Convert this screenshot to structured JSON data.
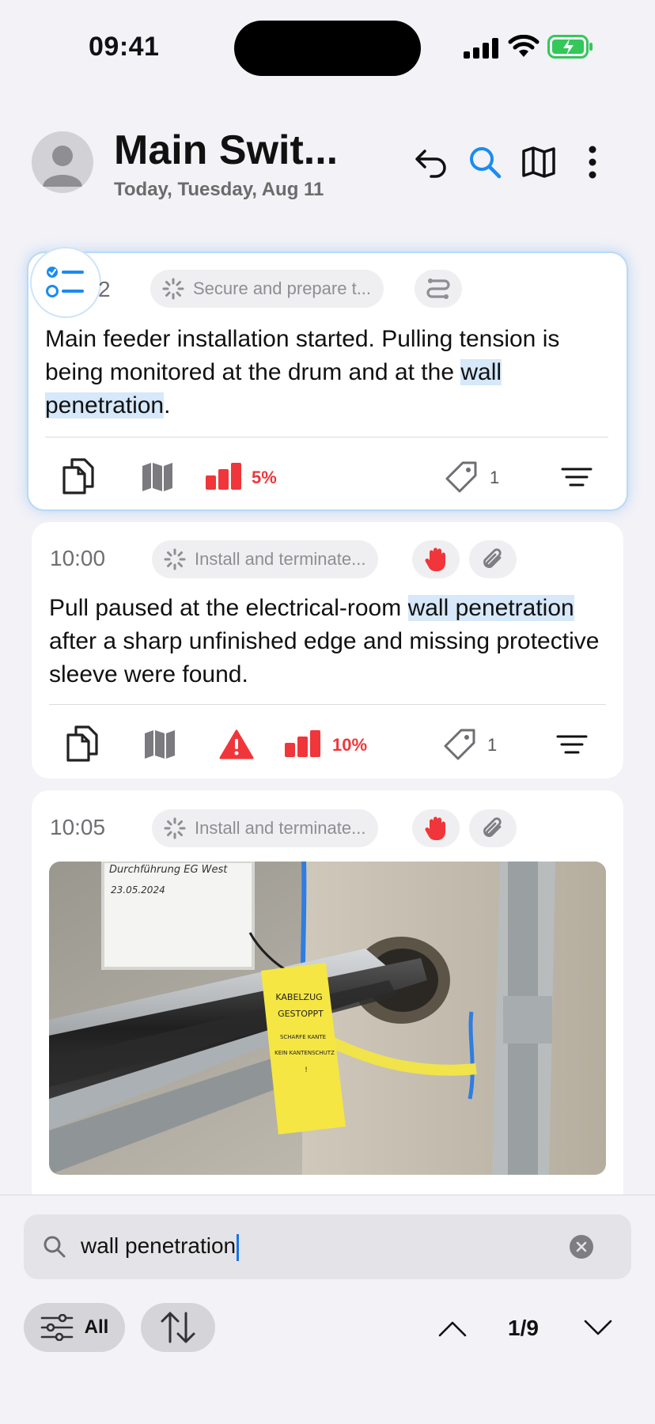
{
  "status_bar": {
    "time": "09:41"
  },
  "header": {
    "title": "Main Swit...",
    "subtitle": "Today, Tuesday, Aug 11"
  },
  "entries": [
    {
      "time": "2",
      "task": "Secure and prepare t...",
      "text_before": "Main feeder installation started. Pulling tension is being monitored at the drum and at the ",
      "highlight": "wall penetration",
      "text_after": ".",
      "progress": "5%",
      "tags_count": "1"
    },
    {
      "time": "10:00",
      "task": "Install and terminate...",
      "text_before": "Pull paused at the electrical-room ",
      "highlight": "wall penetration",
      "text_after": " after a sharp unfinished edge and missing protective sleeve were found.",
      "progress": "10%",
      "tags_count": "1"
    },
    {
      "time": "10:05",
      "task": "Install and terminate...",
      "photo": {
        "board_line1": "Durchführung EG West",
        "board_line2": "23.05.2024",
        "tag_lines": [
          "KABELZUG",
          "GESTOPPT",
          "SCHARFE KANTE",
          "KEIN KANTENSCHUTZ",
          "!"
        ]
      }
    }
  ],
  "search": {
    "value": "wall penetration",
    "filter_label": "All",
    "match_counter": "1/9"
  },
  "colors": {
    "accent": "#1a8cf0",
    "alert": "#f0363a",
    "highlight": "#d6e8f9"
  },
  "icons": [
    "back-arrow-icon",
    "search-icon",
    "map-icon",
    "more-icon",
    "checklist-icon",
    "loading-icon",
    "route-icon",
    "documents-icon",
    "alert-icon",
    "tag-icon",
    "sort-lines-icon",
    "hand-stop-icon",
    "paperclip-icon",
    "filter-sliders-icon",
    "sort-arrows-icon",
    "chevron-up-icon",
    "chevron-down-icon",
    "clear-icon"
  ]
}
